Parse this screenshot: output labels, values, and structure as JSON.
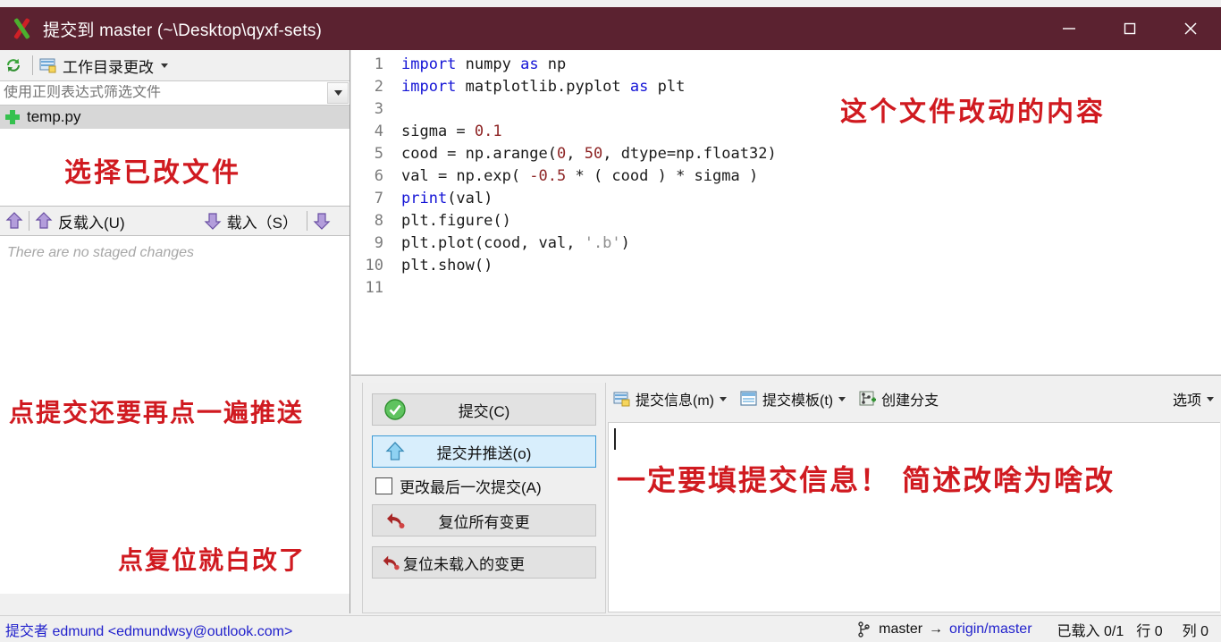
{
  "window": {
    "title": "提交到 master (~\\Desktop\\qyxf-sets)",
    "app_icon": "tortoisegit-x-icon",
    "minimize_label": "最小化",
    "maximize_label": "最大化",
    "close_label": "关闭",
    "titlebar_color": "#5b2230"
  },
  "left_panel": {
    "refresh_icon": "refresh-icon",
    "working_dir_icon": "file-changes-icon",
    "working_dir_label": "工作目录更改",
    "filter": {
      "placeholder": "使用正则表达式筛选文件",
      "value": "",
      "dropdown_icon": "chevron-down-icon"
    },
    "files": [
      {
        "status_icon": "plus-added-icon",
        "name": "temp.py"
      }
    ],
    "stage_toolbar": {
      "unstage_icon_left": "arrow-up-icon",
      "unstage_icon": "arrow-up-icon",
      "unstage_label": "反载入(U)",
      "stage_icon": "arrow-down-icon",
      "stage_label": "载入（S）",
      "stage_icon_right": "arrow-down-icon"
    },
    "staged_empty_text": "There are no staged changes"
  },
  "code_panel": {
    "lines": [
      {
        "n": "1",
        "tokens": [
          {
            "t": "import",
            "c": "kw"
          },
          {
            "t": " numpy ",
            "c": ""
          },
          {
            "t": "as",
            "c": "kw"
          },
          {
            "t": " np",
            "c": ""
          }
        ]
      },
      {
        "n": "2",
        "tokens": [
          {
            "t": "import",
            "c": "kw"
          },
          {
            "t": " matplotlib.pyplot ",
            "c": ""
          },
          {
            "t": "as",
            "c": "kw"
          },
          {
            "t": " plt",
            "c": ""
          }
        ]
      },
      {
        "n": "3",
        "tokens": []
      },
      {
        "n": "4",
        "tokens": [
          {
            "t": "sigma = ",
            "c": ""
          },
          {
            "t": "0.1",
            "c": "num"
          }
        ]
      },
      {
        "n": "5",
        "tokens": [
          {
            "t": "cood = np.arange(",
            "c": ""
          },
          {
            "t": "0",
            "c": "num"
          },
          {
            "t": ", ",
            "c": ""
          },
          {
            "t": "50",
            "c": "num"
          },
          {
            "t": ", dtype=np.float32)",
            "c": ""
          }
        ]
      },
      {
        "n": "6",
        "tokens": [
          {
            "t": "val = np.exp( ",
            "c": ""
          },
          {
            "t": "-0.5",
            "c": "num"
          },
          {
            "t": " * ( cood ) * sigma )",
            "c": ""
          }
        ]
      },
      {
        "n": "7",
        "tokens": [
          {
            "t": "print",
            "c": "kw"
          },
          {
            "t": "(val)",
            "c": ""
          }
        ]
      },
      {
        "n": "8",
        "tokens": [
          {
            "t": "plt.figure()",
            "c": ""
          }
        ]
      },
      {
        "n": "9",
        "tokens": [
          {
            "t": "plt.plot(cood, val, ",
            "c": ""
          },
          {
            "t": "'.b'",
            "c": "str"
          },
          {
            "t": ")",
            "c": ""
          }
        ]
      },
      {
        "n": "10",
        "tokens": [
          {
            "t": "plt.show()",
            "c": ""
          }
        ]
      },
      {
        "n": "11",
        "tokens": []
      }
    ]
  },
  "commit_buttons": {
    "commit": {
      "label": "提交(C)",
      "icon": "green-check-icon"
    },
    "commit_push": {
      "label": "提交并推送(o)",
      "icon": "blue-up-arrow-icon"
    },
    "amend": {
      "label": "更改最后一次提交(A)",
      "checked": false
    },
    "reset_all": {
      "label": "复位所有变更",
      "icon": "undo-red-icon"
    },
    "reset_unstaged": {
      "label": "复位未载入的变更",
      "icon": "undo-red-icon"
    }
  },
  "message_pane": {
    "toolbar": [
      {
        "icon": "commit-message-icon",
        "label": "提交信息(m)",
        "has_caret": true
      },
      {
        "icon": "commit-template-icon",
        "label": "提交模板(t)",
        "has_caret": true
      },
      {
        "icon": "create-branch-icon",
        "label": "创建分支",
        "has_caret": false
      }
    ],
    "options_label": "选项",
    "options_caret_icon": "chevron-down-icon",
    "message_value": ""
  },
  "statusbar": {
    "author_prefix": "提交者",
    "author": "edmund <edmundwsy@outlook.com>",
    "branch_icon": "branch-icon",
    "branch": "master",
    "arrow": "→",
    "remote": "origin/master",
    "staged_label": "已载入",
    "staged_value": "0/1",
    "line_label": "行",
    "line_value": "0",
    "col_label": "列",
    "col_value": "0"
  },
  "annotations": {
    "color": "#d01a20",
    "select_file": "选择已改文件",
    "diff_content": "这个文件改动的内容",
    "commit_then_push": "点提交还要再点一遍推送",
    "reset_warning": "点复位就白改了",
    "must_fill_message": "一定要填提交信息！ 简述改啥为啥改"
  }
}
